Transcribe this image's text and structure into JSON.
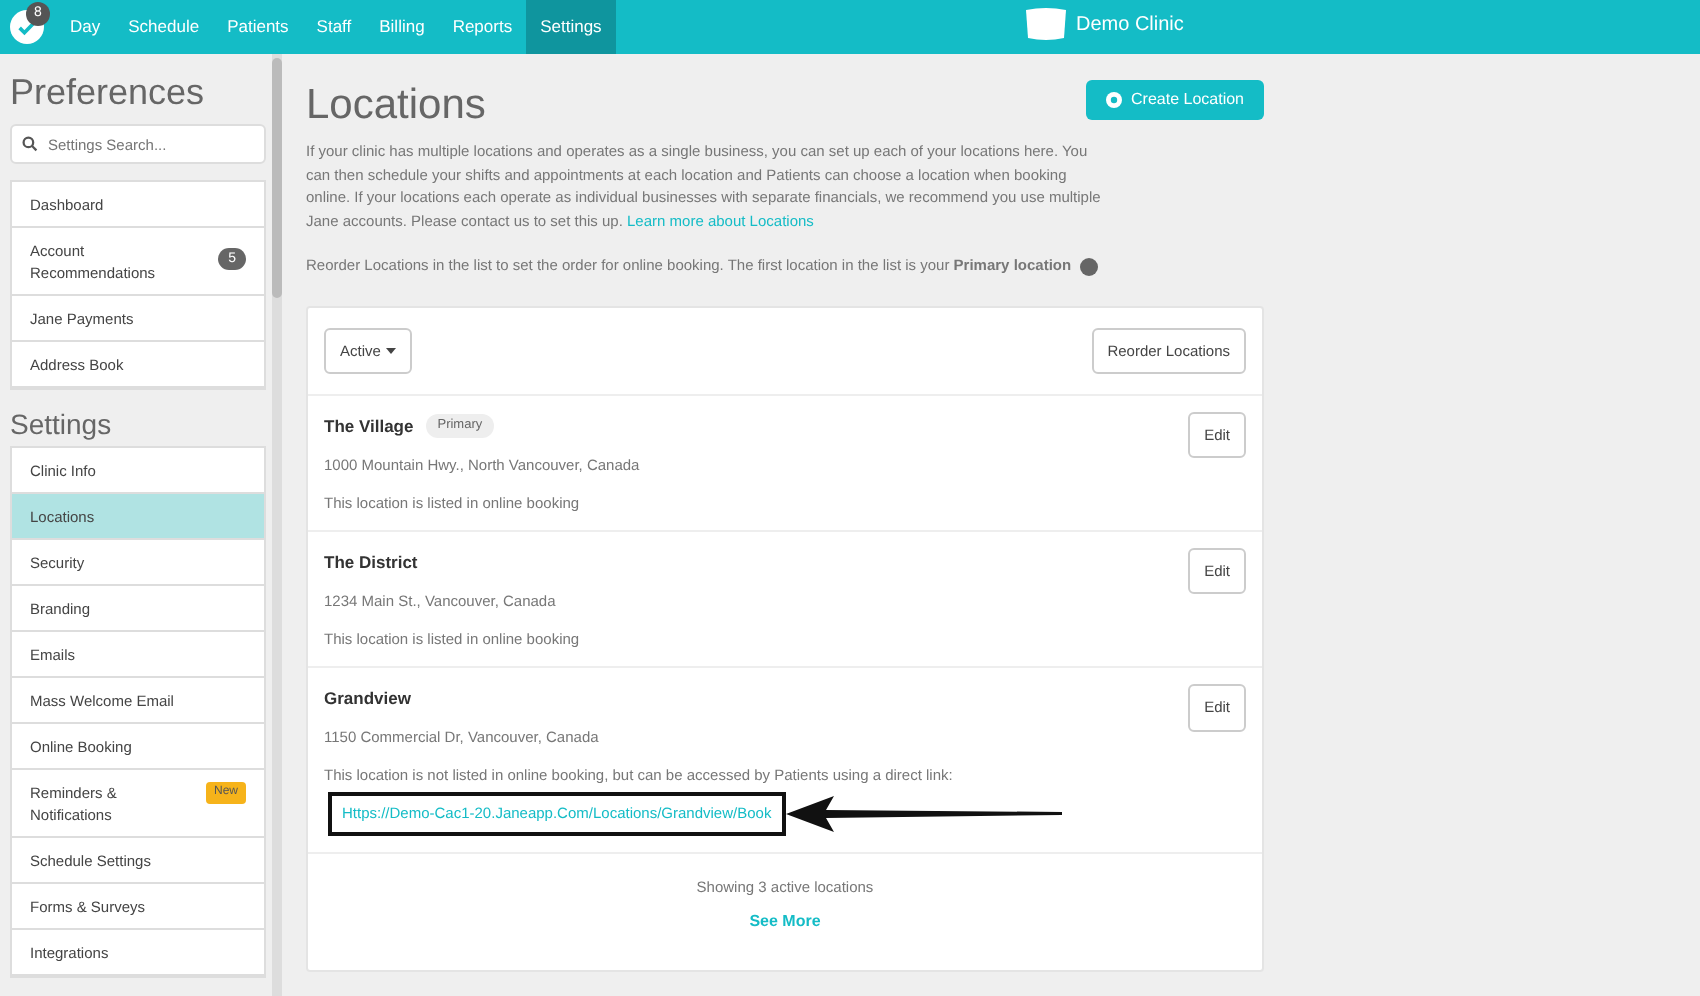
{
  "topbar": {
    "notification_count": "8",
    "tabs": [
      {
        "label": "Day",
        "selected": false
      },
      {
        "label": "Schedule",
        "selected": false
      },
      {
        "label": "Patients",
        "selected": false
      },
      {
        "label": "Staff",
        "selected": false
      },
      {
        "label": "Billing",
        "selected": false
      },
      {
        "label": "Reports",
        "selected": false
      },
      {
        "label": "Settings",
        "selected": true
      }
    ],
    "brand": "Demo Clinic"
  },
  "sidebar": {
    "preferences_heading": "Preferences",
    "search": {
      "placeholder": "Settings Search..."
    },
    "preferences_items": [
      {
        "label": "Dashboard"
      },
      {
        "label": "Account Recommendations",
        "count": "5"
      },
      {
        "label": "Jane Payments"
      },
      {
        "label": "Address Book"
      }
    ],
    "settings_heading": "Settings",
    "settings_items": [
      {
        "label": "Clinic Info",
        "selected": false
      },
      {
        "label": "Locations",
        "selected": true
      },
      {
        "label": "Security",
        "selected": false
      },
      {
        "label": "Branding",
        "selected": false
      },
      {
        "label": "Emails",
        "selected": false
      },
      {
        "label": "Mass Welcome Email",
        "selected": false
      },
      {
        "label": "Online Booking",
        "selected": false
      },
      {
        "label": "Reminders & Notifications",
        "selected": false,
        "tag": "New"
      },
      {
        "label": "Schedule Settings",
        "selected": false
      },
      {
        "label": "Forms & Surveys",
        "selected": false
      },
      {
        "label": "Integrations",
        "selected": false
      }
    ]
  },
  "main": {
    "title": "Locations",
    "create_button": "Create Location",
    "intro": {
      "text": "If your clinic has multiple locations and operates as a single business, you can set up each of your locations here. You can then schedule your shifts and appointments at each location and Patients can choose a location when booking online. If your locations each operate as individual businesses with separate financials, we recommend you use multiple Jane accounts. Please contact us to set this up.",
      "link": "Learn more about Locations"
    },
    "reorder_note": "Reorder Locations in the list to set the order for online booking. The first location in the list is your **Primary location**",
    "filter_button": "Active",
    "reorder_button": "Reorder Locations",
    "locations": [
      {
        "name": "The Village",
        "tag": "Primary",
        "address": "1000 Mountain Hwy., North Vancouver, Canada",
        "listing": "This location is listed in online booking",
        "edit": "Edit"
      },
      {
        "name": "The District",
        "address": "1234 Main St., Vancouver, Canada",
        "listing": "This location is listed in online booking",
        "edit": "Edit"
      },
      {
        "name": "Grandview",
        "address": "1150 Commercial Dr, Vancouver, Canada",
        "listing": "This location is not listed in online booking, but can be accessed by Patients using a direct link:",
        "link": "Https://Demo-Cac1-20.Janeapp.Com/Locations/Grandview/Book",
        "annotated": true,
        "edit": "Edit"
      }
    ],
    "footer": "Showing 3 active locations",
    "see_more": "See More"
  }
}
